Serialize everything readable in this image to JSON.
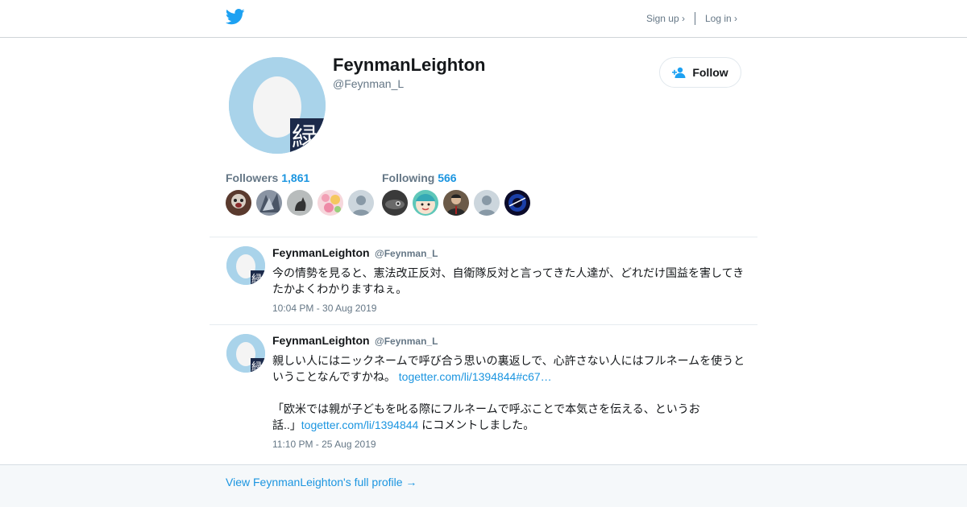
{
  "topbar": {
    "logo_icon": "twitter-bird-icon",
    "signup_label": "Sign up ›",
    "login_label": "Log in ›"
  },
  "profile": {
    "name": "FeynmanLeighton",
    "handle": "@Feynman_L",
    "follow_label": "Follow",
    "avatar_badge_glyph": "緑"
  },
  "stats": {
    "followers_label": "Followers",
    "followers_count": "1,861",
    "following_label": "Following",
    "following_count": "566"
  },
  "tweets": [
    {
      "name": "FeynmanLeighton",
      "handle": "@Feynman_L",
      "text": "今の情勢を見ると、憲法改正反対、自衛隊反対と言ってきた人達が、どれだけ国益を害してきたかよくわかりますねぇ。",
      "time": "10:04 PM - 30 Aug 2019"
    },
    {
      "name": "FeynmanLeighton",
      "handle": "@Feynman_L",
      "text_1": "親しい人にはニックネームで呼び合う思いの裏返しで、心許さない人にはフルネームを使うということなんですかね。",
      "link_1": "togetter.com/li/1394844#c67…",
      "text_2": "「欧米では親が子どもを叱る際にフルネームで呼ぶことで本気さを伝える、というお話..」",
      "link_2": "togetter.com/li/1394844",
      "text_3": " にコメントしました。",
      "time": "11:10 PM - 25 Aug 2019"
    }
  ],
  "footer": {
    "link_label": "View FeynmanLeighton's full profile →"
  },
  "colors": {
    "accent": "#1b95e0",
    "twitter_blue": "#1da1f2",
    "avatar_bg": "#a9d3ea",
    "muted_text": "#657786"
  }
}
